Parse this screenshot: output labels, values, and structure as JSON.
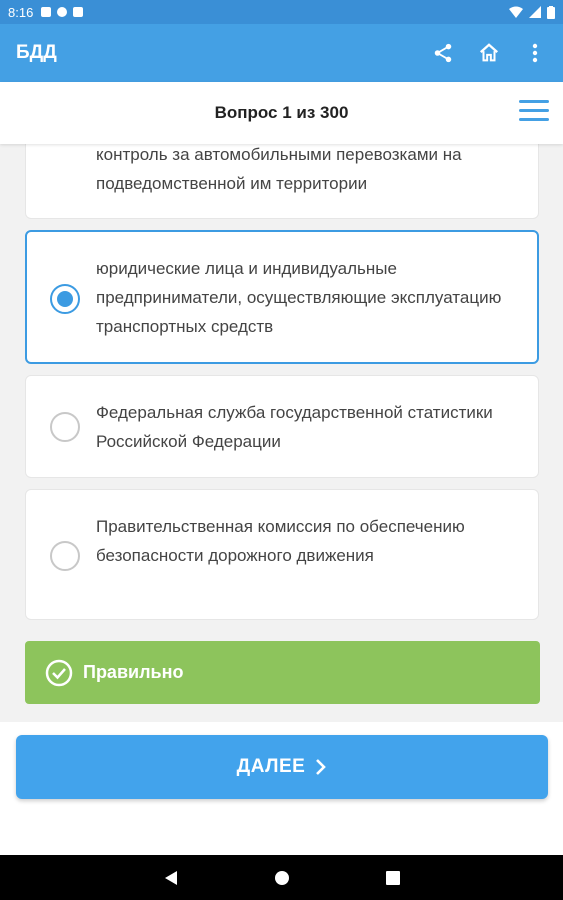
{
  "status_bar": {
    "time": "8:16"
  },
  "app_bar": {
    "title": "БДД",
    "icons": [
      "share-icon",
      "home-icon",
      "more-vert-icon"
    ]
  },
  "question_header": {
    "label": "Вопрос 1 из 300"
  },
  "options": [
    {
      "text": "контроль за автомобильными перевозками на подведомственной им территории",
      "selected": false
    },
    {
      "text": "юридические лица и индивидуальные предприниматели, осуществляющие эксплуатацию транспортных средств",
      "selected": true
    },
    {
      "text": "Федеральная служба государственной статистики Российской Федерации",
      "selected": false
    },
    {
      "text": "Правительственная комиссия по обеспечению безопасности дорожного движения",
      "selected": false
    }
  ],
  "result": {
    "label": "Правильно",
    "color": "#8dc45c"
  },
  "next_button": {
    "label": "ДАЛЕЕ"
  },
  "colors": {
    "accent": "#44a0e4",
    "radio": "#3c9be2"
  }
}
